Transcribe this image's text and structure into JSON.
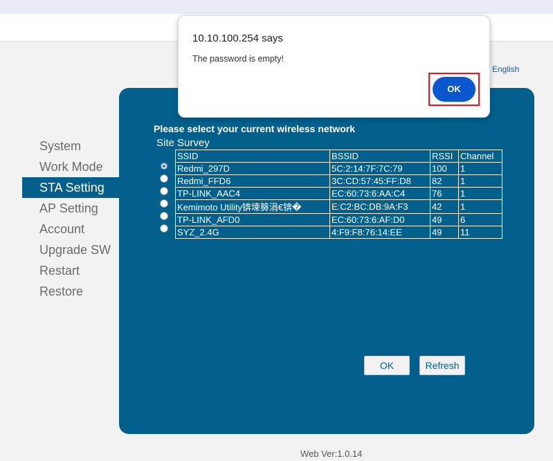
{
  "language": "English",
  "nav": {
    "items": [
      {
        "label": "System"
      },
      {
        "label": "Work Mode"
      },
      {
        "label": "STA Setting"
      },
      {
        "label": "AP Setting"
      },
      {
        "label": "Account"
      },
      {
        "label": "Upgrade SW"
      },
      {
        "label": "Restart"
      },
      {
        "label": "Restore"
      }
    ],
    "active": "STA Setting"
  },
  "panel": {
    "title": "Please select your current wireless network",
    "site_survey_label": "Site Survey",
    "table": {
      "headers": [
        "SSID",
        "BSSID",
        "RSSI",
        "Channel"
      ],
      "rows": [
        [
          "Redmi_297D",
          "5C:2:14:7F:7C:79",
          "100",
          "1"
        ],
        [
          "Redmi_FFD6",
          "3C:CD:57:45:FF:D8",
          "82",
          "1"
        ],
        [
          "TP-LINK_AAC4",
          "EC:60:73:6:AA:C4",
          "76",
          "1"
        ],
        [
          "Kemimoto Utility锛堜簩涓€锛�",
          "E:C2:BC:DB:9A:F3",
          "42",
          "1"
        ],
        [
          "TP-LINK_AFD0",
          "EC:60:73:6:AF:D0",
          "49",
          "6"
        ],
        [
          "SYZ_2.4G",
          "4:F9:F8:76:14:EE",
          "49",
          "11"
        ]
      ],
      "selected_row": 0
    },
    "ok_label": "OK",
    "refresh_label": "Refresh"
  },
  "footer": {
    "web_version": "Web Ver:1.0.14"
  },
  "dialog": {
    "title": "10.10.100.254 says",
    "message": "The password is empty!",
    "ok_label": "OK"
  },
  "colors": {
    "panel": "#035f8c",
    "dialog_button": "#0b57d0",
    "focus_outline": "#e0161e"
  }
}
